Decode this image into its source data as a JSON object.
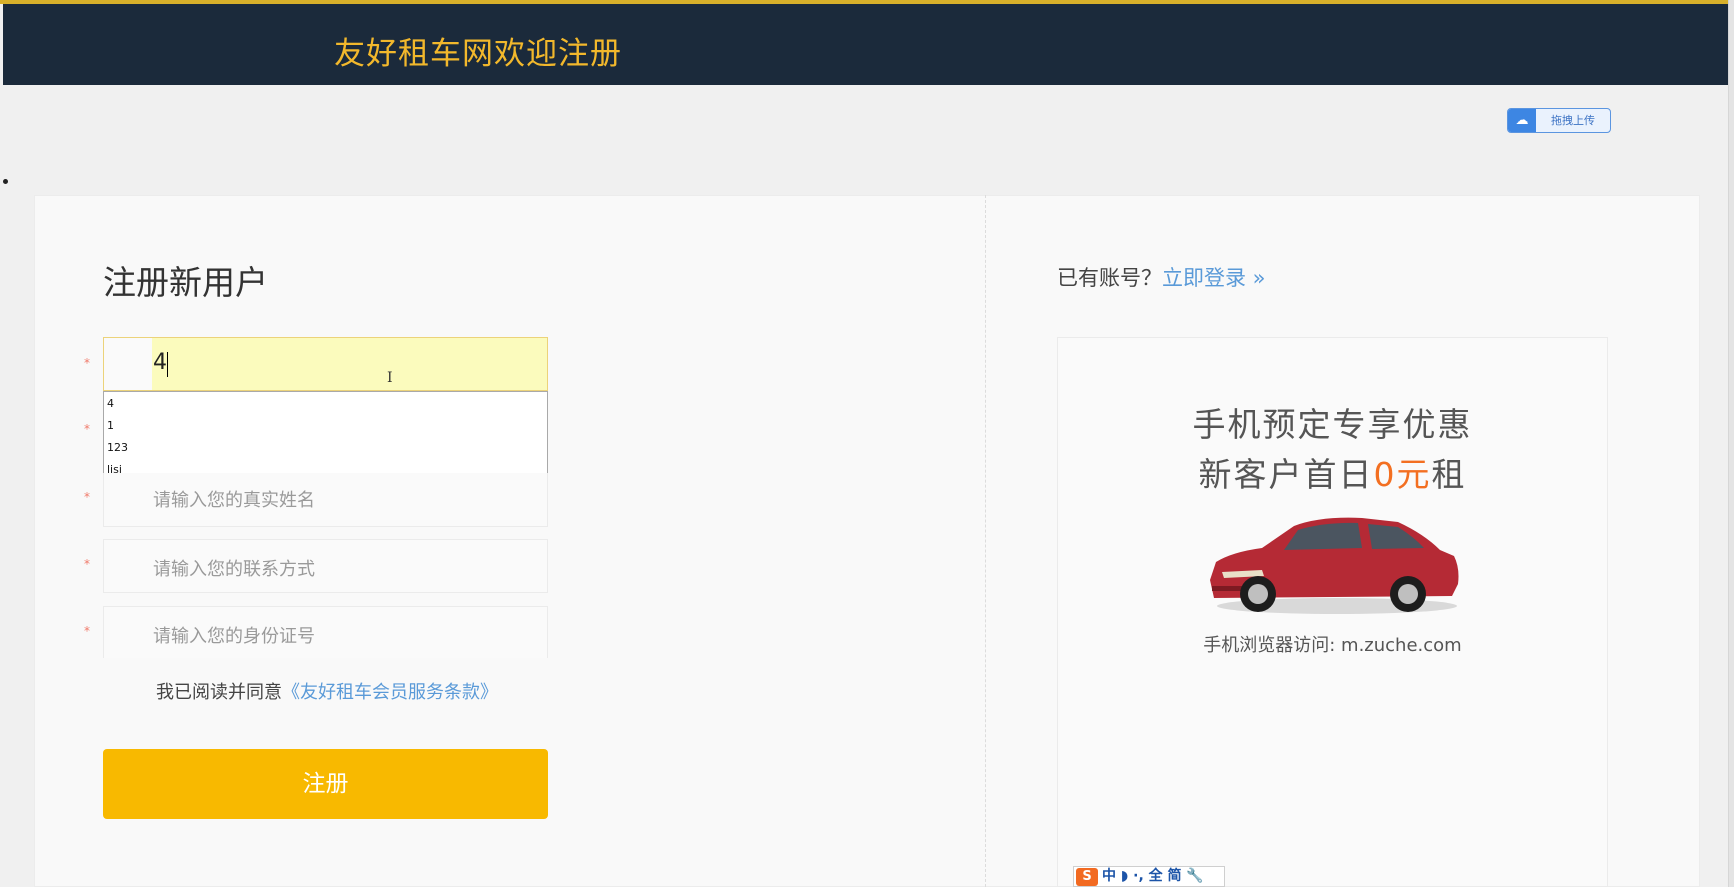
{
  "header": {
    "title": "友好租车网欢迎注册"
  },
  "upload_button": {
    "icon": "cloud-icon",
    "label": "拖拽上传"
  },
  "form": {
    "title": "注册新用户",
    "required_mark": "*",
    "username_value": "4",
    "autocomplete_options": [
      "4",
      "1",
      "123",
      "lisi"
    ],
    "realname_placeholder": "请输入您的真实姓名",
    "contact_placeholder": "请输入您的联系方式",
    "idcard_placeholder": "请输入您的身份证号",
    "agree_text": "我已阅读并同意",
    "agree_link": "《友好租车会员服务条款》",
    "submit_label": "注册"
  },
  "login": {
    "prompt": "已有账号？",
    "link": "立即登录 »"
  },
  "promo": {
    "line1": "手机预定专享优惠",
    "line2_prefix": "新客户首日",
    "line2_highlight": "0元",
    "line2_suffix": "租",
    "url_text": "手机浏览器访问: m.zuche.com"
  },
  "ime_toolbar": {
    "logo": "S",
    "items": "中 ◗ ·, 全 简 🔧"
  },
  "colors": {
    "header_bg": "#1b2a3b",
    "accent_yellow": "#f8b900",
    "link_blue": "#5a9ad8",
    "promo_orange": "#f36f21"
  }
}
